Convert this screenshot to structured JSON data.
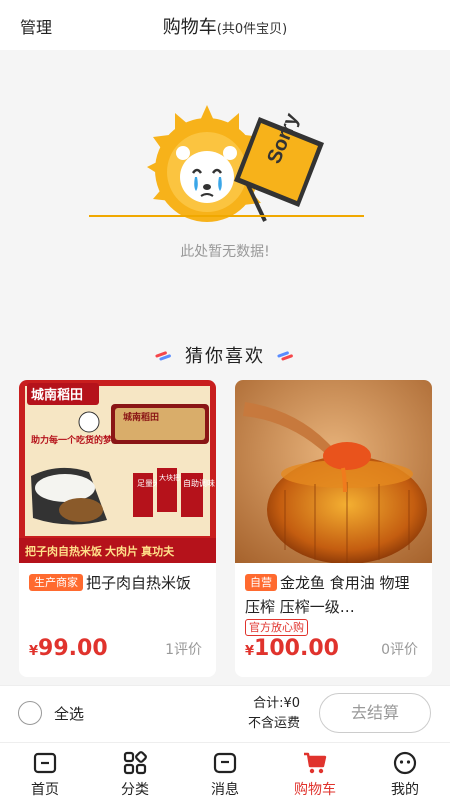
{
  "header": {
    "manage": "管理",
    "title": "购物车",
    "count": "(共0件宝贝)"
  },
  "empty": {
    "sign_text": "Sorry",
    "message": "此处暂无数据!"
  },
  "recommend": {
    "title": "猜你喜欢",
    "products": [
      {
        "tag": "生产商家",
        "name": "把子肉自热米饭",
        "price": "99.00",
        "currency": "¥",
        "reviews": "1评价",
        "image_text": {
          "brand": "城南稻田",
          "slogan": "助力每一个吃货的梦想",
          "pack_brand": "城南稻田",
          "claim1": "足量米饭",
          "claim2": "大块把子肉",
          "claim3": "自助调味",
          "bottom": "把子肉自热米饭  大肉片  真功夫"
        }
      },
      {
        "tag": "自营",
        "name": "金龙鱼 食用油 物理压榨 压榨一级…",
        "badge": "官方放心购",
        "price": "100.00",
        "currency": "¥",
        "reviews": "0评价"
      }
    ]
  },
  "checkout": {
    "select_all": "全选",
    "total_label": "合计:",
    "total_value": "¥0",
    "shipping": "不含运费",
    "button": "去结算"
  },
  "tabs": [
    {
      "label": "首页",
      "icon": "home-icon",
      "active": false
    },
    {
      "label": "分类",
      "icon": "category-icon",
      "active": false
    },
    {
      "label": "消息",
      "icon": "message-icon",
      "active": false
    },
    {
      "label": "购物车",
      "icon": "cart-icon",
      "active": true
    },
    {
      "label": "我的",
      "icon": "profile-icon",
      "active": false
    }
  ],
  "colors": {
    "accent": "#e0332d",
    "tag": "#ff6a2f",
    "sun": "#f7b21a",
    "background": "#f5f5f5"
  }
}
